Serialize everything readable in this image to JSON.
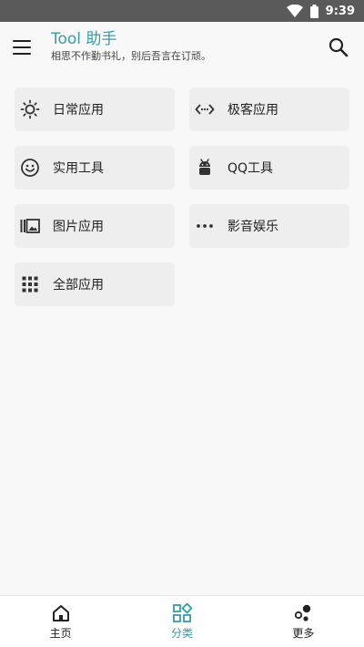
{
  "status_bar": {
    "time": "9:39"
  },
  "app_bar": {
    "title": "Tool 助手",
    "subtitle": "相思不作勤书礼，别后吾言在订顽。"
  },
  "categories": [
    {
      "label": "日常应用",
      "icon": "sun-icon"
    },
    {
      "label": "极客应用",
      "icon": "code-icon"
    },
    {
      "label": "实用工具",
      "icon": "smile-icon"
    },
    {
      "label": "QQ工具",
      "icon": "android-icon"
    },
    {
      "label": "图片应用",
      "icon": "image-icon"
    },
    {
      "label": "影音娱乐",
      "icon": "more-horizontal-icon"
    },
    {
      "label": "全部应用",
      "icon": "grid-icon"
    }
  ],
  "bottom_nav": {
    "items": [
      {
        "label": "主页",
        "icon": "home-icon",
        "active": false
      },
      {
        "label": "分类",
        "icon": "category-icon",
        "active": true
      },
      {
        "label": "更多",
        "icon": "bubbles-icon",
        "active": false
      }
    ]
  },
  "colors": {
    "accent": "#3a9ba3",
    "card_bg": "#eeeeee",
    "status_bar": "#5a5a5a"
  }
}
